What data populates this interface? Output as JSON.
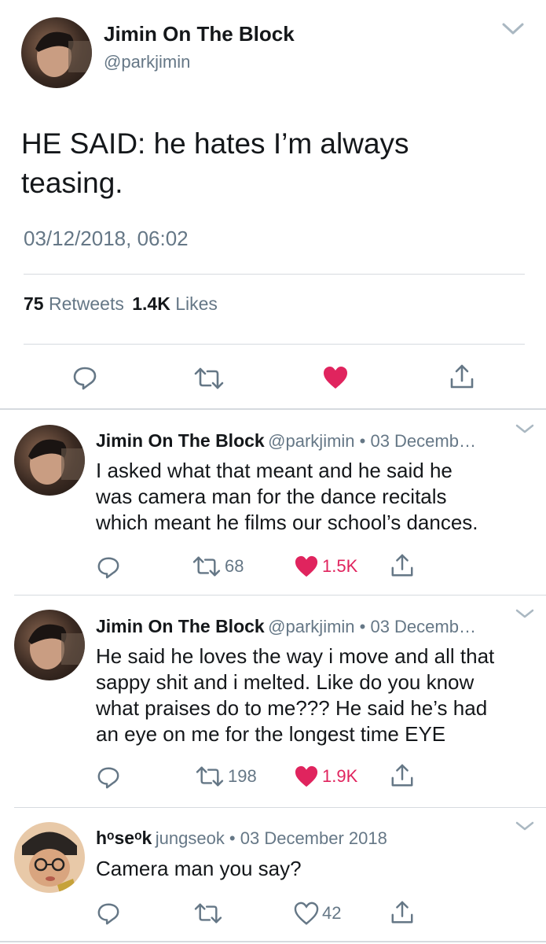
{
  "main": {
    "name": "Jimin On The Block",
    "handle": "@parkjimin",
    "text_line1": "HE SAID: he hates I’m always",
    "text_line2": "teasing.",
    "timestamp": "03/12/2018, 06:02",
    "retweets_count": "75",
    "retweets_label": "Retweets",
    "likes_count": "1.4K",
    "likes_label": "Likes"
  },
  "replies": [
    {
      "name": "Jimin On The Block",
      "meta": "@parkjimin • 03 Decemb…",
      "lines": [
        "I asked what that meant and he said he",
        "was camera man for the dance recitals",
        "which meant he films our school’s dances."
      ],
      "retweets": "68",
      "likes": "1.5K",
      "liked": true
    },
    {
      "name": "Jimin On The Block",
      "meta": "@parkjimin • 03 Decemb…",
      "lines": [
        "He said he loves the way i move and all that",
        "sappy shit and i melted. Like do you know",
        "what praises do to me??? He said he’s had",
        "an eye on me for the longest time EYE"
      ],
      "retweets": "198",
      "likes": "1.9K",
      "liked": true
    },
    {
      "name": "hᵒseᵒk",
      "meta": "jungseok • 03 December 2018",
      "lines": [
        "Camera man you say?"
      ],
      "retweets": "",
      "likes": "42",
      "liked": false
    }
  ],
  "colors": {
    "like_red": "#e0245e",
    "muted_gray": "#657786",
    "divider": "#d6dadf"
  },
  "icons": [
    "reply-icon",
    "retweet-icon",
    "heart-icon",
    "share-icon",
    "chevron-down-icon"
  ]
}
